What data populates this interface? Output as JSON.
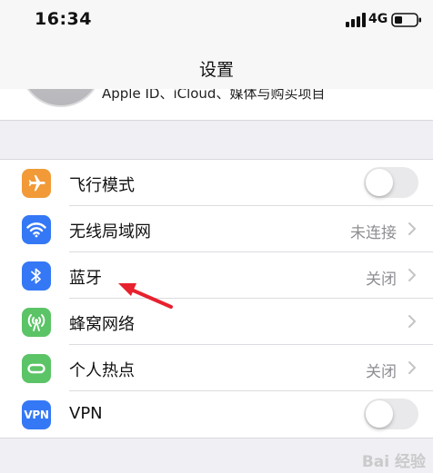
{
  "status_bar": {
    "time": "16:34",
    "network_type": "4G",
    "signal_icon": "signal-bars-icon",
    "battery_icon": "battery-icon"
  },
  "nav": {
    "title": "设置"
  },
  "apple_id": {
    "subtitle": "Apple ID、iCloud、媒体与购买项目"
  },
  "settings": [
    {
      "label": "飞行模式",
      "icon": "airplane-icon",
      "icon_color": "#f19a37",
      "control": "toggle",
      "toggle_on": false
    },
    {
      "label": "无线局域网",
      "value": "未连接",
      "icon": "wifi-icon",
      "icon_color": "#3478f6",
      "control": "chevron"
    },
    {
      "label": "蓝牙",
      "value": "关闭",
      "icon": "bluetooth-icon",
      "icon_color": "#3478f6",
      "control": "chevron"
    },
    {
      "label": "蜂窝网络",
      "icon": "cellular-icon",
      "icon_color": "#5bc466",
      "control": "chevron"
    },
    {
      "label": "个人热点",
      "value": "关闭",
      "icon": "hotspot-icon",
      "icon_color": "#5bc466",
      "control": "chevron"
    },
    {
      "label": "VPN",
      "icon": "vpn-icon",
      "icon_color": "#3478f6",
      "icon_text": "VPN",
      "control": "toggle",
      "toggle_on": false
    }
  ],
  "annotation": {
    "arrow_color": "#e8212e"
  },
  "watermark": {
    "text": "Bai 经验"
  }
}
